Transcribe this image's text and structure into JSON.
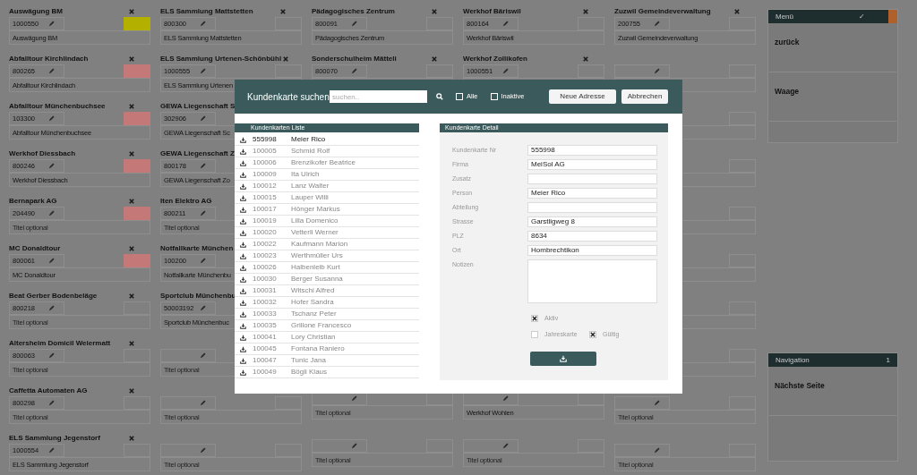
{
  "background": {
    "columns": [
      {
        "cards": [
          {
            "kind": "entry",
            "title": "Auswägung BM",
            "number": "1000550",
            "subtitle": "Auswägung BM",
            "color": "#b4b000"
          },
          {
            "kind": "entry",
            "title": "Abfalltour Kirchlindach",
            "number": "800265",
            "subtitle": "Abfalltour Kirchlindach",
            "color": "#c47878"
          },
          {
            "kind": "entry",
            "title": "Abfalltour Münchenbuchsee",
            "number": "103300",
            "subtitle": "Abfalltour Münchenbuchsee",
            "color": "#c47878"
          },
          {
            "kind": "entry",
            "title": "Werkhof Diessbach",
            "number": "800246",
            "subtitle": "Werkhof Diessbach",
            "color": "#c47878"
          },
          {
            "kind": "entry",
            "title": "Bernapark AG",
            "number": "204490",
            "placeholder": "Titel optional",
            "color": "#c47878"
          },
          {
            "kind": "entry",
            "title": "MC Donaldtour",
            "number": "800061",
            "subtitle": "MC Donaldtour",
            "color": "#c47878"
          },
          {
            "kind": "entry",
            "title": "Beat Gerber Bodenbeläge",
            "number": "800218",
            "placeholder": "Titel optional"
          },
          {
            "kind": "entry",
            "title": "Altersheim Domicil Weiermatt",
            "number": "800063",
            "placeholder": "Titel optional"
          },
          {
            "kind": "entry",
            "title": "Caffetta Automaten AG",
            "number": "800298",
            "placeholder": "Titel optional"
          },
          {
            "kind": "entry",
            "title": "ELS Sammlung Jegenstorf",
            "number": "1000554",
            "subtitle": "ELS Sammlung Jegenstorf"
          }
        ]
      },
      {
        "cards": [
          {
            "kind": "entry",
            "title": "ELS Sammlung Mattstetten",
            "number": "800300",
            "subtitle": "ELS Sammlung Mattstetten"
          },
          {
            "kind": "entry",
            "title": "ELS Sammlung Urtenen-Schönbühl",
            "number": "1000555",
            "subtitle": "ELS Sammlung Urtenen"
          },
          {
            "kind": "partial",
            "title": "GEWA Liegenschaft S",
            "number": "302906",
            "subtitle": "GEWA Liegenschaft Sc"
          },
          {
            "kind": "partial",
            "title": "GEWA Liegenschaft Z",
            "number": "800178",
            "subtitle": "GEWA Liegenschaft Zo"
          },
          {
            "kind": "entry",
            "title": "Iten Elektro AG",
            "number": "800211",
            "placeholder": "Titel optional"
          },
          {
            "kind": "entry",
            "title": "Notfallkarte München",
            "number": "100200",
            "subtitle": "Notfallkarte Münchenbu"
          },
          {
            "kind": "entry",
            "title": "Sportclub Münchenbu",
            "number": "50003192",
            "subtitle": "Sportclub Münchenbuc"
          },
          {
            "kind": "blank",
            "placeholder": "Titel optional"
          },
          {
            "kind": "blank",
            "placeholder": "Titel optional"
          },
          {
            "kind": "blank",
            "placeholder": "Titel optional"
          }
        ]
      },
      {
        "cards": [
          {
            "kind": "entry",
            "title": "Pädagogisches Zentrum",
            "number": "800091",
            "subtitle": "Pädagogisches Zentrum"
          },
          {
            "kind": "entry",
            "title": "Sonderschulheim Mätteli",
            "number": "800070"
          },
          {
            "kind": "hidden"
          },
          {
            "kind": "hidden"
          },
          {
            "kind": "hidden"
          },
          {
            "kind": "hidden"
          },
          {
            "kind": "hidden"
          },
          {
            "kind": "hidden"
          },
          {
            "kind": "blank",
            "placeholder": "Titel optional"
          },
          {
            "kind": "blank",
            "placeholder": "Titel optional"
          }
        ]
      },
      {
        "cards": [
          {
            "kind": "entry",
            "title": "Werkhof Bäriswil",
            "number": "800164",
            "subtitle": "Werkhof Bäriswil"
          },
          {
            "kind": "entry",
            "title": "Werkhof Zollikofen",
            "number": "1000551"
          },
          {
            "kind": "hidden"
          },
          {
            "kind": "hidden"
          },
          {
            "kind": "hidden"
          },
          {
            "kind": "hidden"
          },
          {
            "kind": "hidden"
          },
          {
            "kind": "hidden"
          },
          {
            "kind": "blank",
            "subtitle": "Werkhof Wohlen"
          },
          {
            "kind": "blank",
            "placeholder": "Titel optional"
          }
        ]
      },
      {
        "cards": [
          {
            "kind": "entry",
            "title": "Zuzwil Gemeindeverwaltung",
            "number": "200755",
            "subtitle": "Zuzwil Gemeindeverwaltung"
          },
          {
            "kind": "blank"
          },
          {
            "kind": "blank"
          },
          {
            "kind": "blank"
          },
          {
            "kind": "blank"
          },
          {
            "kind": "blank"
          },
          {
            "kind": "blank"
          },
          {
            "kind": "blank"
          },
          {
            "kind": "blank",
            "placeholder": "Titel optional"
          },
          {
            "kind": "blank",
            "placeholder": "Titel optional"
          }
        ]
      }
    ]
  },
  "sidebar": [
    {
      "title": "Menü",
      "badge": "✓",
      "items": [
        "zurück",
        "Waage"
      ]
    },
    {
      "title": "Navigation",
      "badge": "1",
      "items": [
        "Nächste Seite"
      ]
    }
  ],
  "dialog": {
    "title": "Kundenkarte suchen",
    "search": {
      "placeholder": "suchen.."
    },
    "filters": [
      {
        "label": "Alle",
        "checked": false
      },
      {
        "label": "Inaktive",
        "checked": false
      }
    ],
    "buttons": [
      "Neue Adresse",
      "Abbrechen"
    ],
    "list": {
      "title": "Kundenkarten Liste",
      "rows": [
        {
          "number": "555998",
          "name": "Meier Rico",
          "selected": true
        },
        {
          "number": "100005",
          "name": "Schmid Rolf",
          "selected": false
        },
        {
          "number": "100006",
          "name": "Brenzikofer Beatrice",
          "selected": false
        },
        {
          "number": "100009",
          "name": "Ita Ulrich",
          "selected": false
        },
        {
          "number": "100012",
          "name": "Lanz Walter",
          "selected": false
        },
        {
          "number": "100015",
          "name": "Lauper Willi",
          "selected": false
        },
        {
          "number": "100017",
          "name": "Hönger Markus",
          "selected": false
        },
        {
          "number": "100019",
          "name": "Lilla Domenico",
          "selected": false
        },
        {
          "number": "100020",
          "name": "Vetterli Werner",
          "selected": false
        },
        {
          "number": "100022",
          "name": "Kaufmann Marion",
          "selected": false
        },
        {
          "number": "100023",
          "name": "Werthmüller Urs",
          "selected": false
        },
        {
          "number": "100026",
          "name": "Halbenleib Kurt",
          "selected": false
        },
        {
          "number": "100030",
          "name": "Berger Susanna",
          "selected": false
        },
        {
          "number": "100031",
          "name": "Witschi Alfred",
          "selected": false
        },
        {
          "number": "100032",
          "name": "Hofer Sandra",
          "selected": false
        },
        {
          "number": "100033",
          "name": "Tschanz Peter",
          "selected": false
        },
        {
          "number": "100035",
          "name": "Grillone Francesco",
          "selected": false
        },
        {
          "number": "100041",
          "name": "Lory Christian",
          "selected": false
        },
        {
          "number": "100045",
          "name": "Fontana Raniero",
          "selected": false
        },
        {
          "number": "100047",
          "name": "Tunic Jana",
          "selected": false
        },
        {
          "number": "100049",
          "name": "Bögli Klaus",
          "selected": false
        }
      ]
    },
    "detail": {
      "title": "Kundenkarte Detail",
      "fields": [
        {
          "label": "Kundenkarte Nr",
          "kind": "text",
          "value": "555998"
        },
        {
          "label": "Firma",
          "kind": "text",
          "value": "MeiSol AG"
        },
        {
          "label": "Zusatz",
          "kind": "text"
        },
        {
          "label": "Person",
          "kind": "text",
          "value": "Meier Rico"
        },
        {
          "label": "Abteilung",
          "kind": "text"
        },
        {
          "label": "Strasse",
          "kind": "text",
          "value": "Garstligweg 8"
        },
        {
          "label": "PLZ",
          "kind": "text",
          "value": "8634"
        },
        {
          "label": "Ort",
          "kind": "text",
          "value": "Hombrechtikon"
        },
        {
          "label": "Notizen",
          "kind": "textarea"
        }
      ],
      "checkboxes": [
        {
          "label": "Aktiv",
          "checked": true
        },
        {
          "label": "Jahreskarte",
          "checked": false
        },
        {
          "label": "Gültig",
          "checked": true
        }
      ]
    }
  }
}
